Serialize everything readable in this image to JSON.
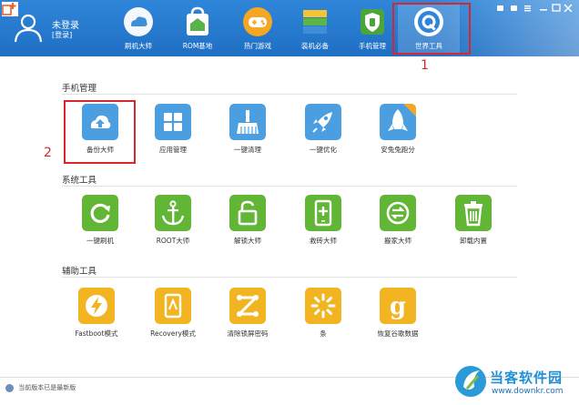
{
  "user": {
    "name": "未登录",
    "login_link": "[登录]"
  },
  "nav": [
    {
      "label": "刷机大师"
    },
    {
      "label": "ROM基地"
    },
    {
      "label": "热门游戏"
    },
    {
      "label": "装机必备"
    },
    {
      "label": "手机管理"
    },
    {
      "label": "世界工具"
    }
  ],
  "annotations": {
    "marker_1": "1",
    "marker_2": "2"
  },
  "sections": [
    {
      "title": "手机管理",
      "tools": [
        {
          "label": "备份大师",
          "icon": "cloud-upload-icon",
          "color": "blue"
        },
        {
          "label": "应用管理",
          "icon": "grid-apps-icon",
          "color": "blue"
        },
        {
          "label": "一键清理",
          "icon": "broom-icon",
          "color": "blue"
        },
        {
          "label": "一键优化",
          "icon": "rocket-icon",
          "color": "blue"
        },
        {
          "label": "安兔兔跑分",
          "icon": "antutu-rocket-icon",
          "color": "blue"
        }
      ]
    },
    {
      "title": "系统工具",
      "tools": [
        {
          "label": "一键刷机",
          "icon": "refresh-icon",
          "color": "green"
        },
        {
          "label": "ROOT大师",
          "icon": "anchor-icon",
          "color": "green"
        },
        {
          "label": "解锁大师",
          "icon": "unlock-icon",
          "color": "green"
        },
        {
          "label": "救砖大师",
          "icon": "phone-plus-icon",
          "color": "green"
        },
        {
          "label": "搬家大师",
          "icon": "transfer-icon",
          "color": "green"
        },
        {
          "label": "卸载内置",
          "icon": "trash-icon",
          "color": "green"
        }
      ]
    },
    {
      "title": "辅助工具",
      "tools": [
        {
          "label": "Fastboot模式",
          "icon": "lightning-icon",
          "color": "yellow"
        },
        {
          "label": "Recovery模式",
          "icon": "tablet-icon",
          "color": "yellow"
        },
        {
          "label": "清除锁屏密码",
          "icon": "pattern-lock-icon",
          "color": "yellow"
        },
        {
          "label": "条",
          "icon": "loading-spinner-icon",
          "color": "yellow"
        },
        {
          "label": "恢复谷歌数据",
          "icon": "google-g-icon",
          "color": "yellow"
        }
      ]
    }
  ],
  "status_text": "当前版本已是最新版",
  "watermark": {
    "name": "当客软件园",
    "url": "www.downkr.com"
  },
  "colors": {
    "topbar": "#2f86d9",
    "blue_tile": "#4b9fe0",
    "green_tile": "#62b636",
    "yellow_tile": "#f2b521",
    "annotation_red": "#d9262c"
  }
}
